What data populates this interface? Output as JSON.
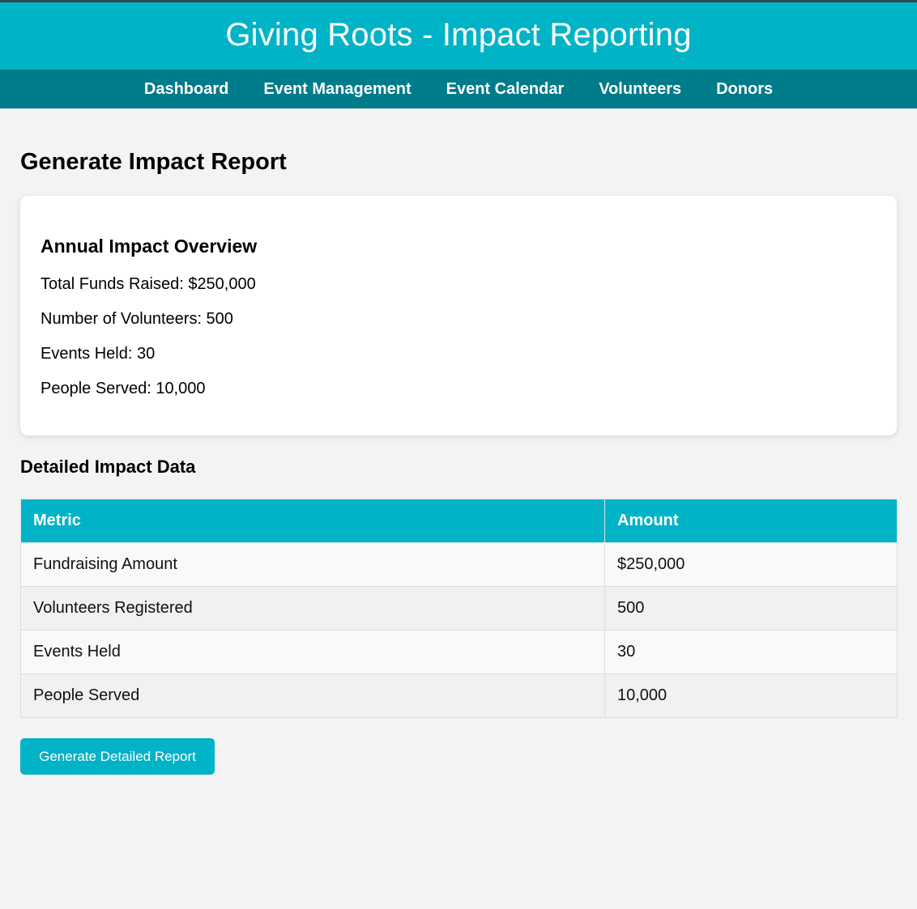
{
  "header": {
    "title": "Giving Roots - Impact Reporting"
  },
  "nav": {
    "items": [
      {
        "label": "Dashboard"
      },
      {
        "label": "Event Management"
      },
      {
        "label": "Event Calendar"
      },
      {
        "label": "Volunteers"
      },
      {
        "label": "Donors"
      }
    ]
  },
  "main": {
    "page_title": "Generate Impact Report",
    "overview": {
      "heading": "Annual Impact Overview",
      "stats": [
        {
          "text": "Total Funds Raised: $250,000"
        },
        {
          "text": "Number of Volunteers: 500"
        },
        {
          "text": "Events Held: 30"
        },
        {
          "text": "People Served: 10,000"
        }
      ]
    },
    "detail": {
      "heading": "Detailed Impact Data",
      "columns": [
        "Metric",
        "Amount"
      ],
      "rows": [
        {
          "metric": "Fundraising Amount",
          "amount": "$250,000"
        },
        {
          "metric": "Volunteers Registered",
          "amount": "500"
        },
        {
          "metric": "Events Held",
          "amount": "30"
        },
        {
          "metric": "People Served",
          "amount": "10,000"
        }
      ]
    },
    "generate_button_label": "Generate Detailed Report"
  },
  "colors": {
    "primary": "#00b3c6",
    "nav": "#007b8a",
    "background": "#f3f3f3"
  }
}
